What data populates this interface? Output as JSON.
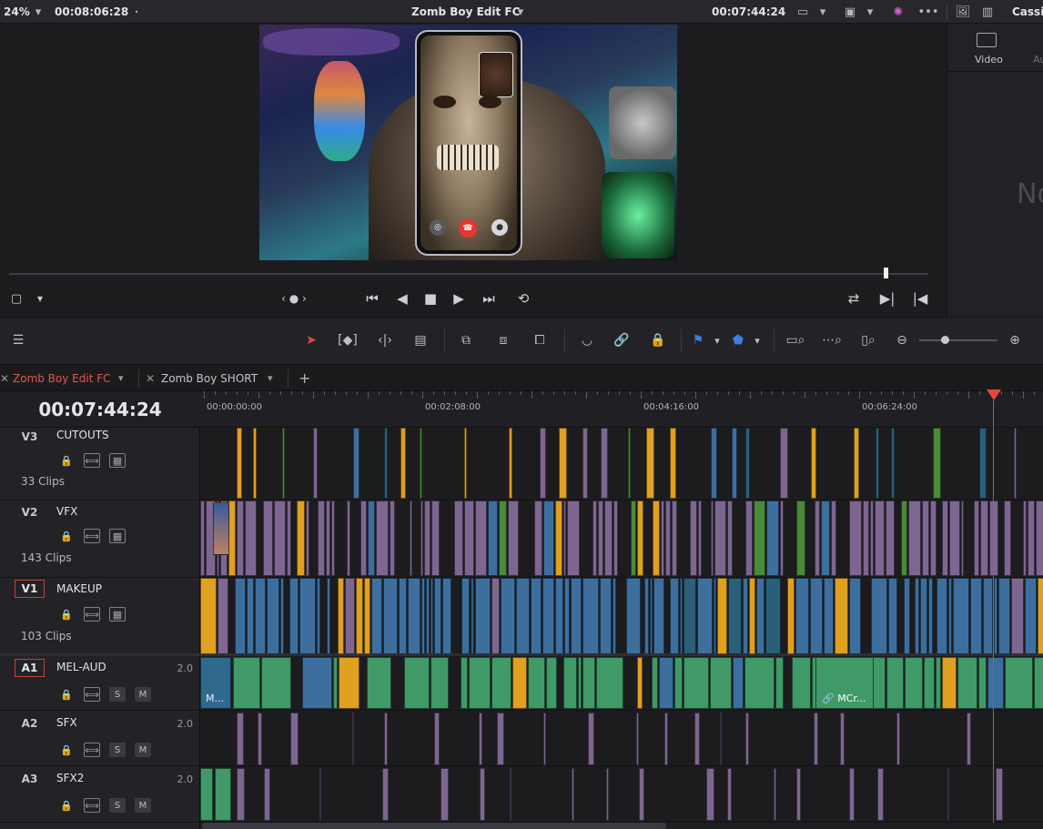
{
  "topbar": {
    "zoom": "24%",
    "duration": "00:08:06:28",
    "timeline_name": "Zomb Boy Edit FC",
    "timecode": "00:07:44:24",
    "user": "Cassi"
  },
  "inspector": {
    "tab_video": "Video",
    "tab_audio": "Au",
    "empty_text": "No"
  },
  "tabs": [
    {
      "label": "Zomb Boy Edit FC",
      "active": true
    },
    {
      "label": "Zomb Boy SHORT",
      "active": false
    }
  ],
  "timeline": {
    "timecode": "00:07:44:24",
    "ruler": [
      "00:00:00:00",
      "00:02:08:00",
      "00:04:16:00",
      "00:06:24:00"
    ],
    "tracks": [
      {
        "id": "V3",
        "name": "CUTOUTS",
        "count": "33 Clips",
        "channels": ""
      },
      {
        "id": "V2",
        "name": "VFX",
        "count": "143 Clips",
        "channels": ""
      },
      {
        "id": "V1",
        "name": "MAKEUP",
        "count": "103 Clips",
        "channels": ""
      },
      {
        "id": "A1",
        "name": "MEL-AUD",
        "count": "",
        "channels": "2.0"
      },
      {
        "id": "A2",
        "name": "SFX",
        "count": "",
        "channels": "2.0"
      },
      {
        "id": "A3",
        "name": "SFX2",
        "count": "",
        "channels": "2.0"
      }
    ],
    "solo_label": "S",
    "mute_label": "M",
    "clip_labels": {
      "a1_first": "M...",
      "a1_linked": "MCr..."
    }
  },
  "colors": {
    "accent_red": "#e04a40",
    "clip_blue": "#3d6f9e",
    "clip_purple": "#7d6690",
    "clip_orange": "#e0a020",
    "clip_audio": "#3f9a68",
    "clip_teal": "#2a5f7a"
  }
}
